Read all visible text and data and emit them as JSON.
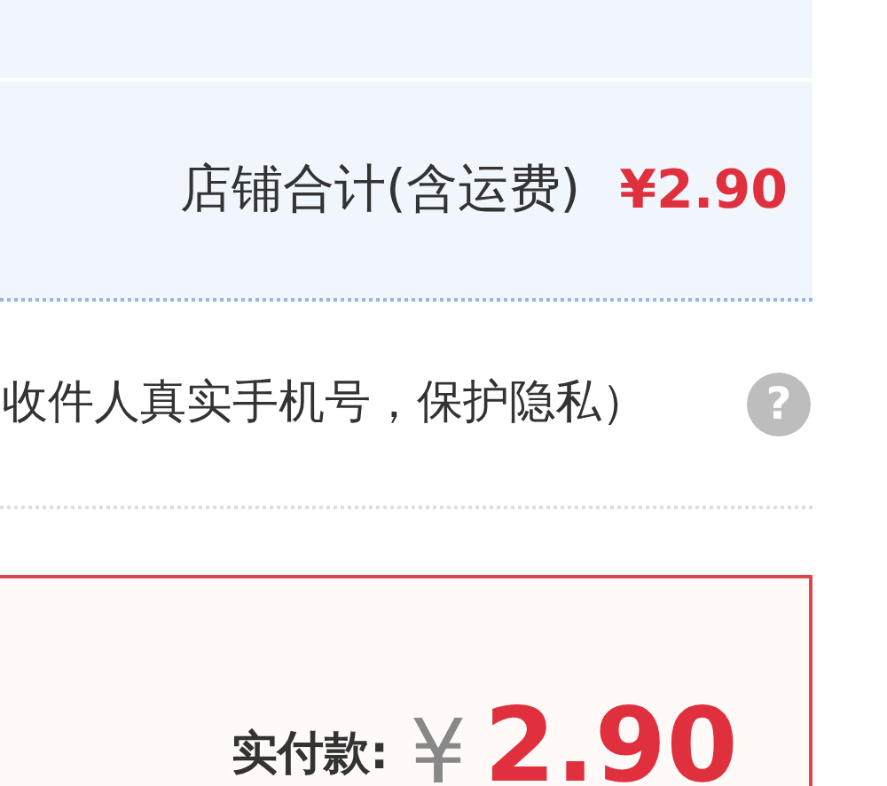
{
  "shop_total": {
    "label": "店铺合计(含运费)",
    "amount": "¥2.90"
  },
  "privacy_note": {
    "text": "收件人真实手机号，保护隐私）",
    "help_icon": "?"
  },
  "payment": {
    "label": "实付款:",
    "currency": "¥",
    "amount": "2.90"
  }
}
